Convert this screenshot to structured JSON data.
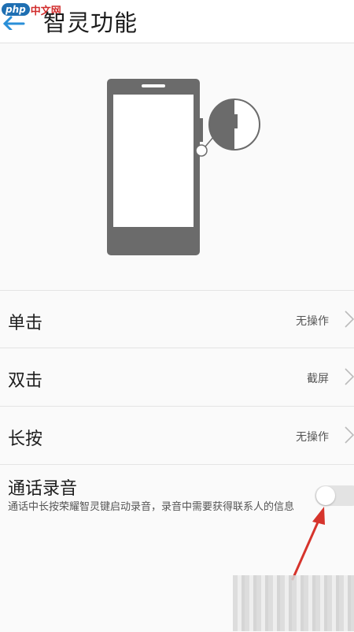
{
  "watermark": {
    "brand": "php",
    "suffix": "中文网"
  },
  "header": {
    "title": "智灵功能"
  },
  "rows": [
    {
      "label": "单击",
      "value": "无操作"
    },
    {
      "label": "双击",
      "value": "截屏"
    },
    {
      "label": "长按",
      "value": "无操作"
    }
  ],
  "call_recording": {
    "title": "通话录音",
    "description": "通话中长按荣耀智灵键启动录音，录音中需要获得联系人的信息",
    "enabled": false
  },
  "colors": {
    "accent": "#2a8fd8",
    "phone_illustration": "#6b6b6b",
    "annotation_arrow": "#d6342c"
  }
}
